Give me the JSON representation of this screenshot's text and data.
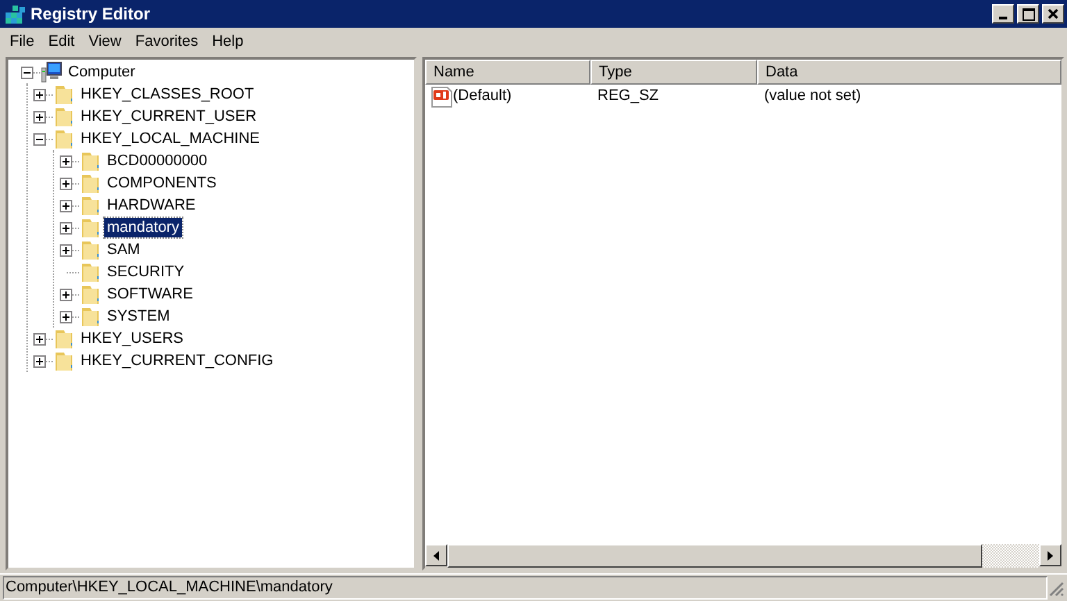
{
  "window": {
    "title": "Registry Editor"
  },
  "menu": [
    "File",
    "Edit",
    "View",
    "Favorites",
    "Help"
  ],
  "tree": [
    {
      "label": "Computer",
      "kind": "computer",
      "expandable": true,
      "expanded": true,
      "selected": false,
      "children": [
        {
          "label": "HKEY_CLASSES_ROOT",
          "kind": "folder",
          "expandable": true,
          "expanded": false,
          "selected": false
        },
        {
          "label": "HKEY_CURRENT_USER",
          "kind": "folder",
          "expandable": true,
          "expanded": false,
          "selected": false
        },
        {
          "label": "HKEY_LOCAL_MACHINE",
          "kind": "folder",
          "expandable": true,
          "expanded": true,
          "selected": false,
          "children": [
            {
              "label": "BCD00000000",
              "kind": "folder",
              "expandable": true,
              "expanded": false,
              "selected": false
            },
            {
              "label": "COMPONENTS",
              "kind": "folder",
              "expandable": true,
              "expanded": false,
              "selected": false
            },
            {
              "label": "HARDWARE",
              "kind": "folder",
              "expandable": true,
              "expanded": false,
              "selected": false
            },
            {
              "label": "mandatory",
              "kind": "folder",
              "expandable": true,
              "expanded": false,
              "selected": true
            },
            {
              "label": "SAM",
              "kind": "folder",
              "expandable": true,
              "expanded": false,
              "selected": false
            },
            {
              "label": "SECURITY",
              "kind": "folder",
              "expandable": false,
              "selected": false
            },
            {
              "label": "SOFTWARE",
              "kind": "folder",
              "expandable": true,
              "expanded": false,
              "selected": false
            },
            {
              "label": "SYSTEM",
              "kind": "folder",
              "expandable": true,
              "expanded": false,
              "selected": false
            }
          ]
        },
        {
          "label": "HKEY_USERS",
          "kind": "folder",
          "expandable": true,
          "expanded": false,
          "selected": false
        },
        {
          "label": "HKEY_CURRENT_CONFIG",
          "kind": "folder",
          "expandable": true,
          "expanded": false,
          "selected": false
        }
      ]
    }
  ],
  "table": {
    "columns": [
      "Name",
      "Type",
      "Data"
    ],
    "rows": [
      [
        "(Default)",
        "REG_SZ",
        "(value not set)"
      ]
    ]
  },
  "status_bar": "Computer\\HKEY_LOCAL_MACHINE\\mandatory"
}
